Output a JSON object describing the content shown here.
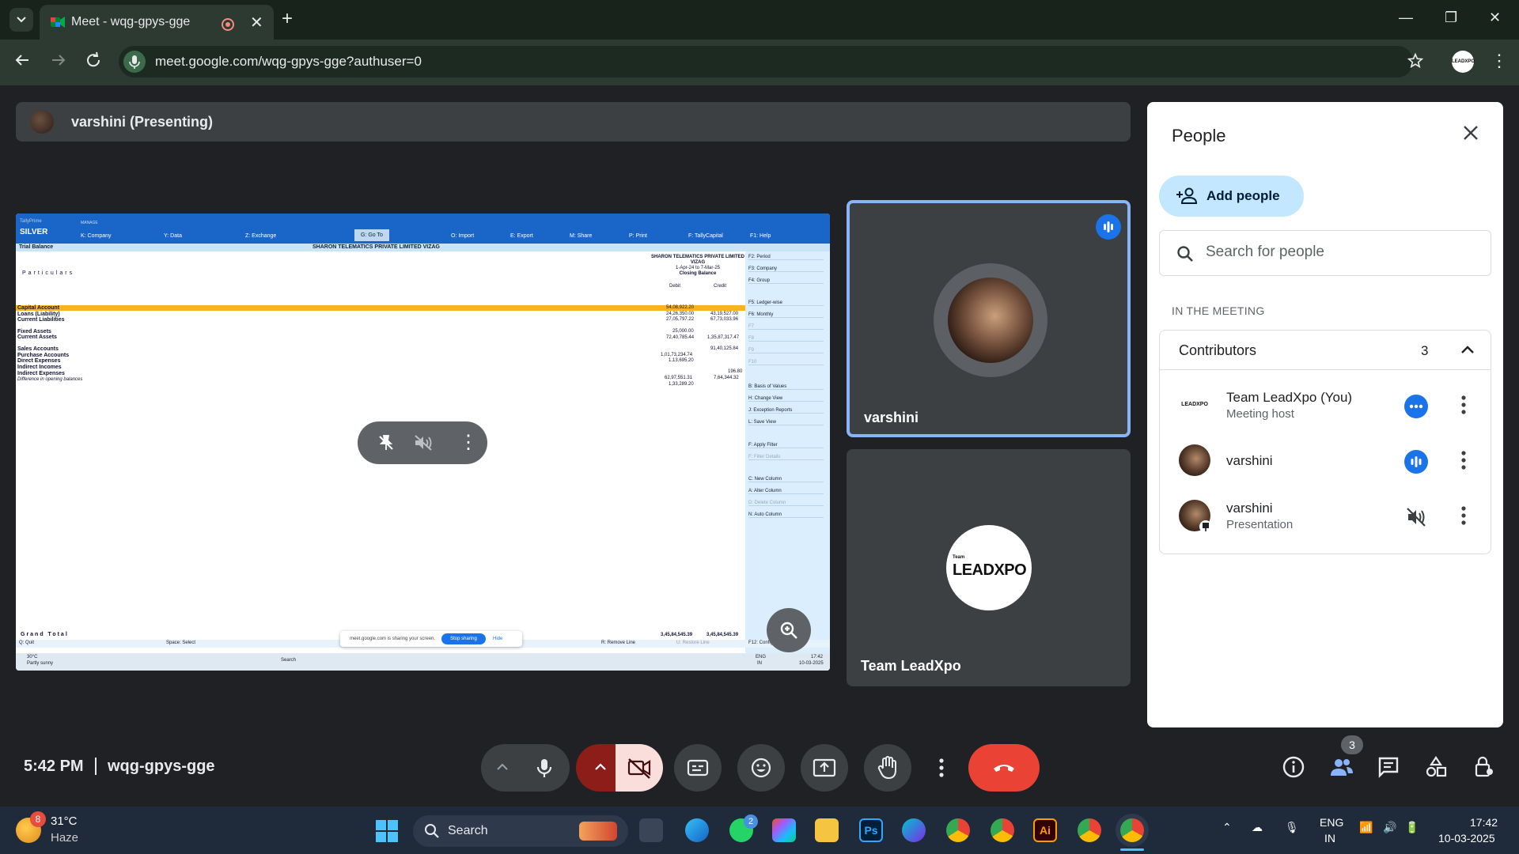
{
  "browser": {
    "tab_title": "Meet - wqg-gpys-gge",
    "url": "meet.google.com/wqg-gpys-gge?authuser=0",
    "profile_label": "LEADXPO"
  },
  "presenting_bar": {
    "label": "varshini (Presenting)"
  },
  "shared_screen": {
    "app_name": "TallyPrime",
    "edition": "SILVER",
    "manage": "MANAGE",
    "menu": [
      "K: Company",
      "Y: Data",
      "Z: Exchange",
      "G: Go To",
      "O: Import",
      "E: Export",
      "M: Share",
      "P: Print",
      "F: TallyCapital",
      "F1: Help"
    ],
    "report_title": "Trial Balance",
    "company_title": "SHARON TELEMATICS PRIVATE LIMITED VIZAG",
    "col_heading": "Particulars",
    "col_company": "SHARON TELEMATICS PRIVATE LIMITED VIZAG",
    "col_period": "1-Apr-24 to 7-Mar-25",
    "col_balance": "Closing Balance",
    "col_debit": "Debit",
    "col_credit": "Credit",
    "rows": [
      {
        "name": "Capital Account",
        "debit": "54,08,922.20",
        "credit": ""
      },
      {
        "name": "Loans (Liability)",
        "debit": "24,26,350.00",
        "credit": "43,19,527.00"
      },
      {
        "name": "Current Liabilities",
        "debit": "27,05,797.22",
        "credit": "67,73,033.96"
      },
      {
        "name": "Fixed Assets",
        "debit": "25,000.00",
        "credit": ""
      },
      {
        "name": "Current Assets",
        "debit": "72,40,785.44",
        "credit": "1,35,87,317.47"
      },
      {
        "name": "Sales Accounts",
        "debit": "",
        "credit": "91,40,125.84"
      },
      {
        "name": "Purchase Accounts",
        "debit": "1,01,73,234.74",
        "credit": ""
      },
      {
        "name": "Direct Expenses",
        "debit": "1,13,695.20",
        "credit": ""
      },
      {
        "name": "Indirect Incomes",
        "debit": "",
        "credit": "196.80"
      },
      {
        "name": "Indirect Expenses",
        "debit": "62,97,551.31",
        "credit": "7,64,344.32"
      },
      {
        "name": "Difference in opening balances",
        "debit": "1,33,289.20",
        "credit": ""
      }
    ],
    "grand_total_label": "Grand Total",
    "grand_total_debit": "3,45,84,545.39",
    "grand_total_credit": "3,45,84,545.39",
    "right_panel": [
      "F2: Period",
      "F3: Company",
      "F4: Group",
      "F5: Ledger-wise",
      "F6: Monthly",
      "F7",
      "F8",
      "F9",
      "F10",
      "B: Basis of Values",
      "H: Change View",
      "J: Exception Reports",
      "L: Save View",
      "F: Apply Filter",
      "F: Filter Details",
      "C: New Column",
      "A: Alter Column",
      "D: Delete Column",
      "N: Auto Column"
    ],
    "bottom_bar": [
      "Q: Quit",
      "Space: Select",
      "R: Remove Line",
      "U: Restore Line",
      "F12: Configure"
    ],
    "share_notice": "meet.google.com is sharing your screen.",
    "stop_sharing": "Stop sharing",
    "hide": "Hide",
    "mini_weather_temp": "30°C",
    "mini_weather_state": "Partly sunny",
    "mini_search": "Search",
    "mini_lang": "ENG",
    "mini_region": "IN",
    "mini_time": "17:42",
    "mini_date": "10-03-2025"
  },
  "tiles": [
    {
      "name": "varshini"
    },
    {
      "name": "Team LeadXpo",
      "logo_small": "Team",
      "logo_main": "LEADXPO"
    }
  ],
  "people_panel": {
    "title": "People",
    "add_people": "Add people",
    "search_placeholder": "Search for people",
    "section": "IN THE MEETING",
    "group_label": "Contributors",
    "group_count": "3",
    "participants": [
      {
        "name": "Team LeadXpo (You)",
        "sub": "Meeting host",
        "avatar_text": "LEADXPO"
      },
      {
        "name": "varshini",
        "sub": ""
      },
      {
        "name": "varshini",
        "sub": "Presentation"
      }
    ]
  },
  "bottom": {
    "time": "5:42 PM",
    "meeting_code": "wqg-gpys-gge",
    "people_count": "3"
  },
  "taskbar": {
    "weather_temp": "31°C",
    "weather_state": "Haze",
    "weather_badge": "8",
    "search": "Search",
    "lang": "ENG",
    "region": "IN",
    "time": "17:42",
    "date": "10-03-2025"
  },
  "colors": {
    "accent_blue": "#1a73e8",
    "end_call_red": "#ea4335",
    "tally_blue": "#1a66c8",
    "highlight_yellow": "#f6b51d"
  }
}
